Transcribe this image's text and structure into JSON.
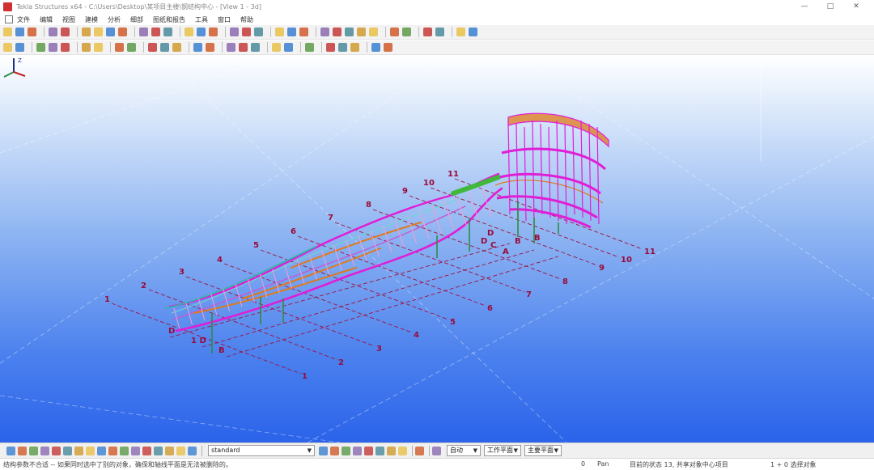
{
  "window": {
    "title": "Tekla Structures x64 - C:\\Users\\Desktop\\某项目主楼\\钢结构中心 - [View 1 - 3d]",
    "controls": [
      "—",
      "□",
      "✕"
    ]
  },
  "menu": [
    "文件",
    "编辑",
    "视图",
    "建模",
    "分析",
    "细部",
    "图纸和报告",
    "工具",
    "窗口",
    "帮助"
  ],
  "toolbar1_icons": [
    "new",
    "open",
    "save",
    "sep",
    "undo",
    "redo",
    "sep",
    "snap",
    "view",
    "zoom",
    "pan",
    "sep",
    "rectangle",
    "circle",
    "select",
    "sep",
    "model",
    "cube",
    "grid",
    "sep",
    "weld",
    "bolt",
    "part",
    "sep",
    "check",
    "clash",
    "report",
    "sep",
    "plane",
    "point",
    "line",
    "arc",
    "polyline",
    "sep",
    "tool",
    "settings",
    "sep",
    "drawing",
    "print",
    "sep",
    "info",
    "help"
  ],
  "toolbar2_icons": [
    "column",
    "beam",
    "sep",
    "plate",
    "slab",
    "panel",
    "sep",
    "pad",
    "strip",
    "sep",
    "bolt",
    "weld",
    "sep",
    "cut",
    "fit",
    "chamfer",
    "sep",
    "point",
    "node",
    "sep",
    "axis",
    "grid",
    "level",
    "sep",
    "dim",
    "text",
    "sep",
    "delete",
    "sep",
    "line",
    "arc",
    "curve",
    "sep",
    "measure",
    "angle"
  ],
  "viewport": {
    "grid_labels_top": [
      "1",
      "2",
      "3",
      "4",
      "5",
      "6",
      "7",
      "8",
      "9",
      "10",
      "11"
    ],
    "grid_labels_bottom": [
      "1",
      "2",
      "3",
      "4",
      "5",
      "6",
      "7",
      "8",
      "9",
      "10",
      "11"
    ],
    "axis_letters": [
      "D",
      "B",
      "D",
      "C",
      "B",
      "A",
      "1 D",
      "B",
      "D"
    ],
    "axis_widget": {
      "label": "Z"
    }
  },
  "bottom": {
    "icons": [
      "select",
      "snap",
      "plane",
      "point",
      "line",
      "arc",
      "node",
      "midpoint",
      "edge",
      "center",
      "ref",
      "grid",
      "free",
      "geom",
      "ext",
      "perp",
      "tangent",
      "sep"
    ],
    "standard_select": "standard",
    "selects": [
      {
        "name": "auto",
        "value": "自动"
      },
      {
        "name": "work-plane",
        "value": "工作平面"
      },
      {
        "name": "main-plane",
        "value": "主要平面"
      }
    ]
  },
  "status": {
    "message": "结构参数不合适 -- 如果同时选中了别的对象，确保和轴线平面是无法被删除的。",
    "coord": "0",
    "mode": "Pan",
    "info": "目前的状态 13, 共享对象中心项目",
    "selection": "1 + 0 选择对象"
  },
  "colors": {
    "viewport_bottom": "#2b63ea",
    "beam_magenta": "#e01ed6",
    "beam_orange": "#e07a1a",
    "beam_green": "#3fb83c",
    "grid_dash": "#a01040"
  }
}
